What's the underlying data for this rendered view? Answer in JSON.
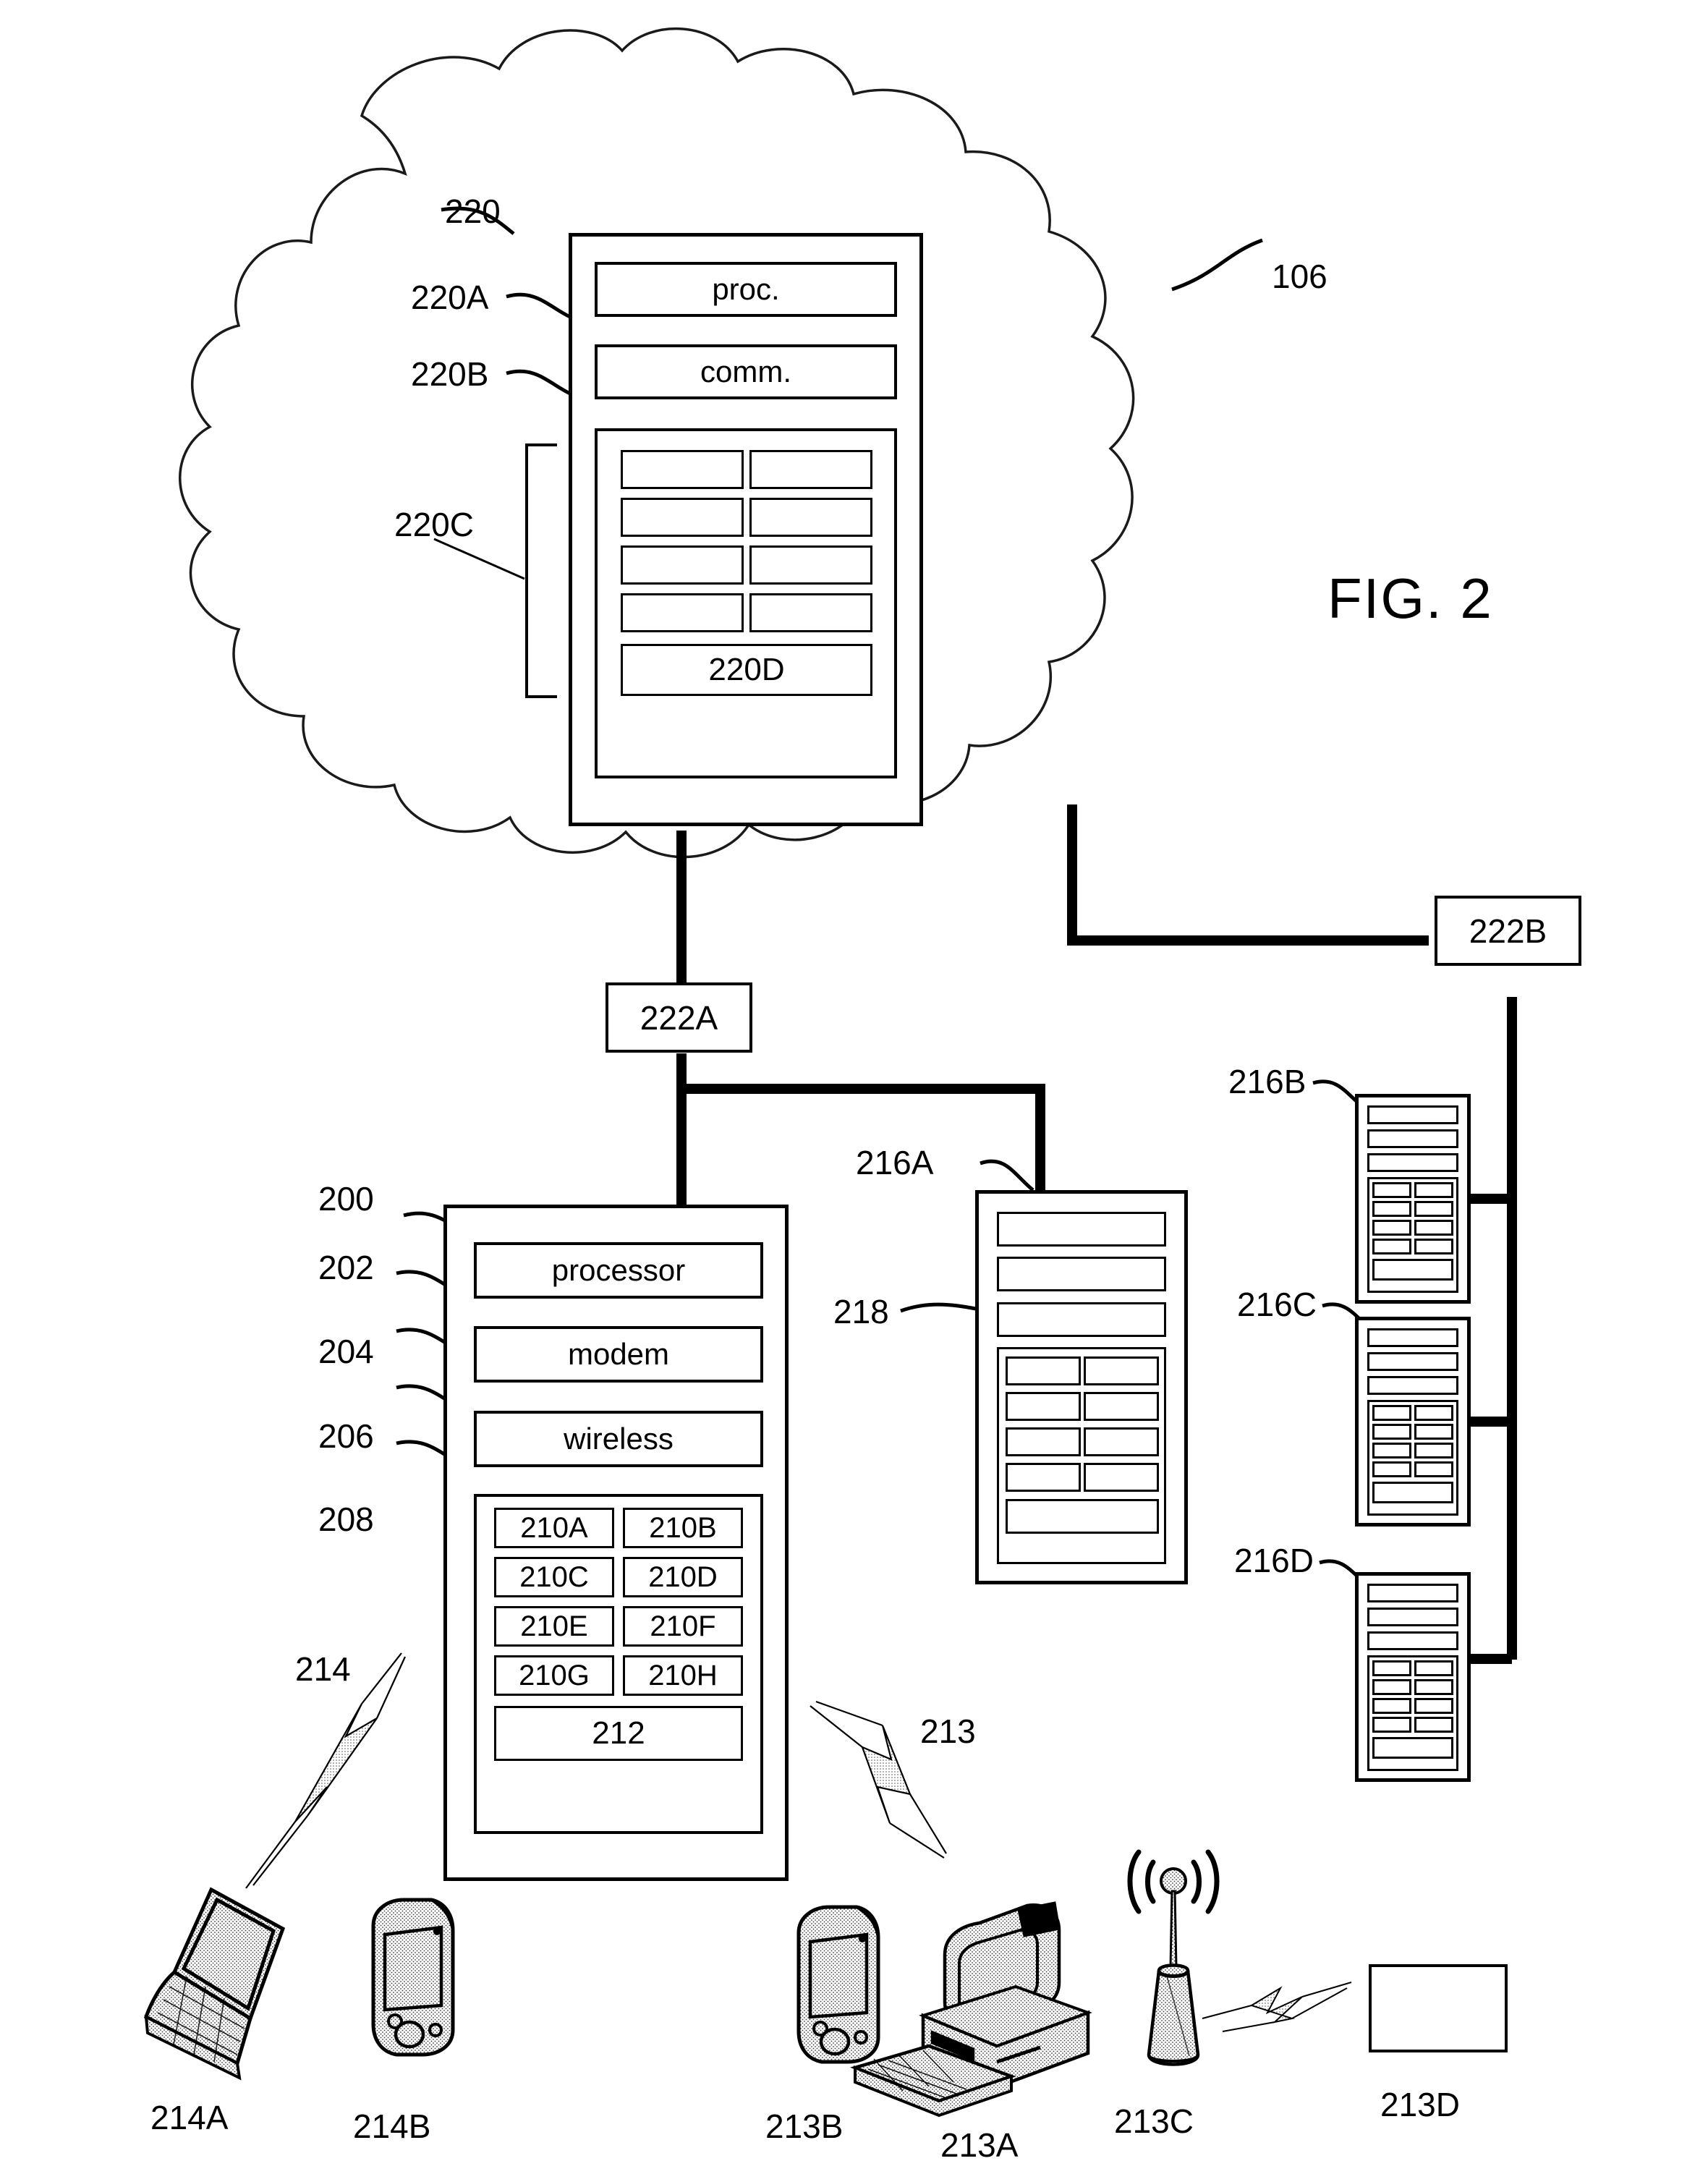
{
  "figure": {
    "title": "FIG. 2",
    "cloud_label": "106"
  },
  "cloud_server": {
    "ref": "220",
    "processor": {
      "ref": "220A",
      "label": "proc."
    },
    "comm": {
      "ref": "220B",
      "label": "comm."
    },
    "modules_bracket_ref": "220C",
    "modules_count": 8,
    "bottom_module": {
      "ref": "220D",
      "label": "220D"
    }
  },
  "routers": [
    {
      "ref": "222A"
    },
    {
      "ref": "222B"
    }
  ],
  "device": {
    "ref": "200",
    "components": [
      {
        "ref": "202",
        "label": "processor"
      },
      {
        "ref": "204",
        "label": "modem"
      },
      {
        "ref": "206",
        "label": "wireless"
      }
    ],
    "module_container_ref": "208",
    "modules": [
      {
        "label": "210A"
      },
      {
        "label": "210B"
      },
      {
        "label": "210C"
      },
      {
        "label": "210D"
      },
      {
        "label": "210E"
      },
      {
        "label": "210F"
      },
      {
        "label": "210G"
      },
      {
        "label": "210H"
      }
    ],
    "bottom_module": {
      "label": "212"
    }
  },
  "servers": [
    {
      "ref": "216A",
      "detail_ref": "218"
    },
    {
      "ref": "216B"
    },
    {
      "ref": "216C"
    },
    {
      "ref": "216D"
    }
  ],
  "wireless_links": [
    {
      "ref": "214"
    },
    {
      "ref": "213"
    }
  ],
  "endpoints": [
    {
      "ref": "214A",
      "icon": "laptop-icon"
    },
    {
      "ref": "214B",
      "icon": "pda-icon"
    },
    {
      "ref": "213B",
      "icon": "pda-icon"
    },
    {
      "ref": "213A",
      "icon": "desktop-computer-icon"
    },
    {
      "ref": "213C",
      "icon": "antenna-tower-icon"
    },
    {
      "ref": "213D",
      "icon": "blank-device-icon"
    }
  ],
  "colors": {
    "line": "#000000",
    "background": "#ffffff"
  }
}
